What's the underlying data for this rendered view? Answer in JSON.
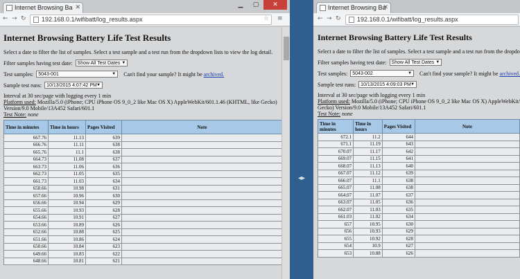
{
  "left": {
    "tab_title": "Internet Browsing Ba",
    "url": "192.168.0.1/wifibatt/log_results.aspx",
    "heading": "Internet Browsing Battery Life Test Results",
    "intro": "Select a date to filter the list of samples. Select a test sample and a test run from the dropdown lists to view the log detail.",
    "filter_label": "Filter samples having test date:",
    "filter_value": "Show All Test Dates",
    "samples_label": "Test samples:",
    "sample_value": "5043-001",
    "cant_find": "Can't find your sample? It might be",
    "archived": "archived.",
    "runs_label": "Sample test runs:",
    "run_value": "10/13/2015 4:07:42 PM",
    "interval": "Interval at 30 sec/page with logging every 1 min",
    "platform_label": "Platform used:",
    "platform_line1": "Mozilla/5.0 (iPhone; CPU iPhone OS 9_0_2 like Mac OS X) AppleWebKit/601.1.46 (KHTML, like Gecko)",
    "platform_line2": "Version/9.0 Mobile/13A452 Safari/601.1",
    "note_label": "Test Note:",
    "note_value": "none",
    "columns": [
      "Time in minutes",
      "Time in hours",
      "Pages Visited",
      "Note"
    ],
    "rows": [
      [
        "667.76",
        "11.13",
        "639"
      ],
      [
        "666.76",
        "11.11",
        "638"
      ],
      [
        "665.76",
        "11.1",
        "638"
      ],
      [
        "664.73",
        "11.08",
        "637"
      ],
      [
        "663.73",
        "11.06",
        "636"
      ],
      [
        "662.73",
        "11.05",
        "635"
      ],
      [
        "661.73",
        "11.03",
        "634"
      ],
      [
        "658.66",
        "10.98",
        "631"
      ],
      [
        "657.66",
        "10.96",
        "630"
      ],
      [
        "656.66",
        "10.94",
        "629"
      ],
      [
        "655.66",
        "10.93",
        "628"
      ],
      [
        "654.66",
        "10.91",
        "627"
      ],
      [
        "653.66",
        "10.89",
        "626"
      ],
      [
        "652.66",
        "10.88",
        "625"
      ],
      [
        "651.66",
        "10.86",
        "624"
      ],
      [
        "650.66",
        "10.84",
        "623"
      ],
      [
        "649.66",
        "10.83",
        "622"
      ],
      [
        "648.66",
        "10.81",
        "621"
      ]
    ]
  },
  "right": {
    "tab_title": "Internet Browsing Ba",
    "url": "192.168.0.1/wifibatt/log_results.aspx",
    "heading": "Internet Browsing Battery Life Test Results",
    "intro": "Select a date to filter the list of samples. Select a test sample and a test run from the dropdown lists to view the log detail.",
    "filter_label": "Filter samples having test date:",
    "filter_value": "Show All Test Dates",
    "samples_label": "Test samples:",
    "sample_value": "5043-002",
    "cant_find": "Can't find your sample? It might be",
    "archived": "archived.",
    "runs_label": "Sample test runs:",
    "run_value": "10/13/2015 4:09:03 PM",
    "interval": "Interval at 30 sec/page with logging every 1 min",
    "platform_label": "Platform used:",
    "platform_line1": "Mozilla/5.0 (iPhone; CPU iPhone OS 9_0_2 like Mac OS X) AppleWebKit/601.1.46 (KHTML, like",
    "platform_line2": "Gecko) Version/9.0 Mobile/13A452 Safari/601.1",
    "note_label": "Test Note:",
    "note_value": "none",
    "columns": [
      "Time in minutes",
      "Time in hours",
      "Pages Visited",
      "Note"
    ],
    "rows": [
      [
        "672.1",
        "11.2",
        "644"
      ],
      [
        "671.1",
        "11.19",
        "643"
      ],
      [
        "670.07",
        "11.17",
        "642"
      ],
      [
        "669.07",
        "11.15",
        "641"
      ],
      [
        "668.07",
        "11.13",
        "640"
      ],
      [
        "667.07",
        "11.12",
        "639"
      ],
      [
        "666.07",
        "11.1",
        "638"
      ],
      [
        "665.07",
        "11.08",
        "638"
      ],
      [
        "664.07",
        "11.07",
        "637"
      ],
      [
        "663.07",
        "11.05",
        "636"
      ],
      [
        "662.07",
        "11.03",
        "635"
      ],
      [
        "661.03",
        "11.02",
        "634"
      ],
      [
        "657",
        "10.95",
        "630"
      ],
      [
        "656",
        "10.93",
        "629"
      ],
      [
        "655",
        "10.92",
        "628"
      ],
      [
        "654",
        "10.9",
        "627"
      ],
      [
        "653",
        "10.88",
        "626"
      ]
    ]
  }
}
